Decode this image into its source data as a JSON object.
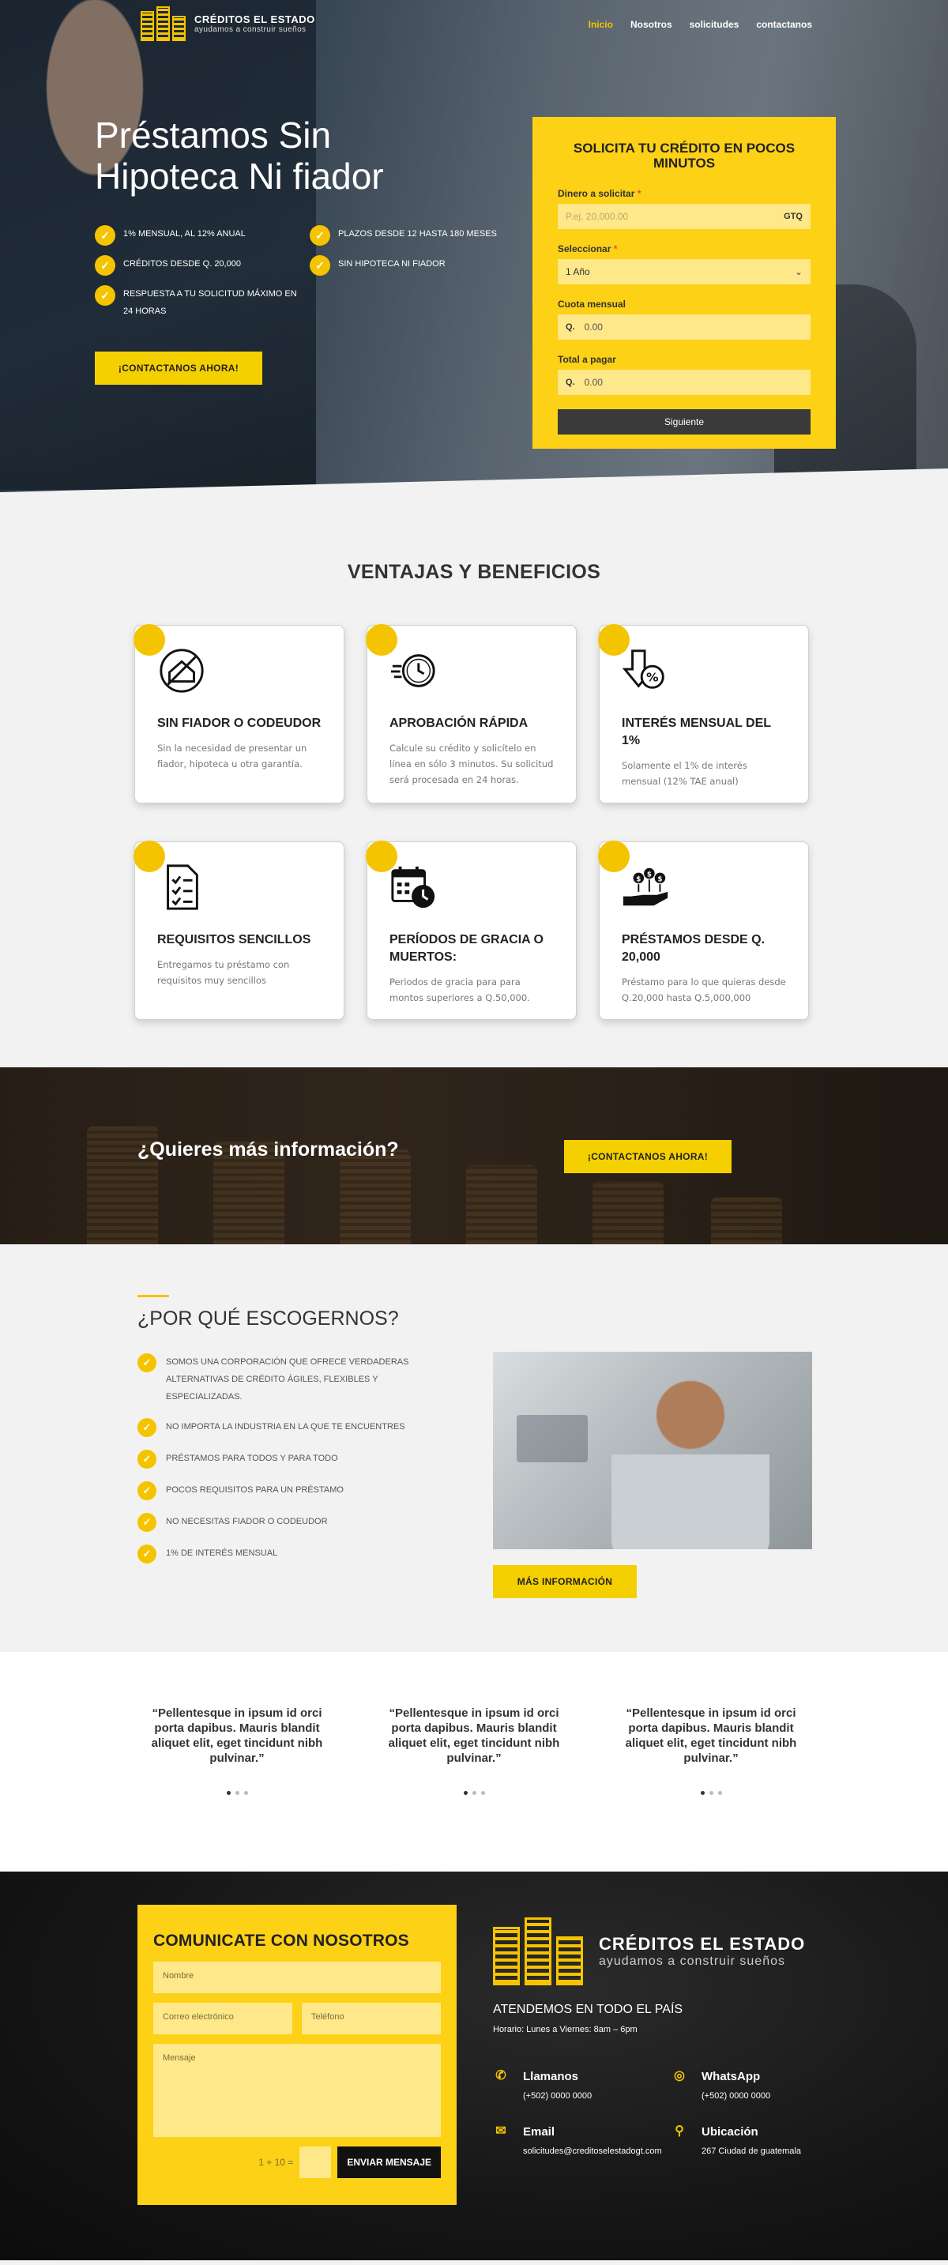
{
  "brand": {
    "name": "CRÉDITOS EL ESTADO",
    "tagline": "ayudamos a construir sueños"
  },
  "nav": {
    "items": [
      "Inicio",
      "Nosotros",
      "solicitudes",
      "contactanos"
    ],
    "active": 0
  },
  "hero": {
    "title": "Préstamos Sin Hipoteca Ni fiador",
    "checks": [
      "1% MENSUAL, AL 12% ANUAL",
      "PLAZOS DESDE 12 HASTA 180 MESES",
      "CRÉDITOS DESDE Q. 20,000",
      "SIN HIPOTECA NI FIADOR",
      "RESPUESTA A TU SOLICITUD MÁXIMO EN 24 HORAS"
    ],
    "cta": "¡CONTACTANOS AHORA!"
  },
  "loan_form": {
    "title": "SOLICITA TU CRÉDITO EN POCOS MINUTOS",
    "amount_label": "Dinero a solicitar",
    "amount_placeholder": "P.ej. 20,000.00",
    "amount_suffix": "GTQ",
    "term_label": "Seleccionar",
    "term_value": "1 Año",
    "quota_label": "Cuota mensual",
    "quota_prefix": "Q.",
    "quota_value": "0.00",
    "total_label": "Total a pagar",
    "total_prefix": "Q.",
    "total_value": "0.00",
    "submit": "Siguiente",
    "required_mark": "*"
  },
  "benefits": {
    "title": "VENTAJAS Y BENEFICIOS",
    "cards": [
      {
        "icon": "house-no-guarantor-icon",
        "title": "SIN FIADOR O CODEUDOR",
        "text": "Sin la necesidad de presentar un fiador, hipoteca u otra garantía."
      },
      {
        "icon": "fast-clock-icon",
        "title": "APROBACIÓN RÁPIDA",
        "text": "Calcule su crédito y solicítelo en línea en sólo 3 minutos. Su solicitud será procesada en 24 horas."
      },
      {
        "icon": "percent-down-arrow-icon",
        "title": "INTERÉS MENSUAL DEL 1%",
        "text": "Solamente el 1% de interés mensual (12% TAE anual)"
      },
      {
        "icon": "checklist-icon",
        "title": "REQUISITOS SENCILLOS",
        "text": "Entregamos tu préstamo con requisitos muy sencillos"
      },
      {
        "icon": "calendar-clock-icon",
        "title": "PERÍODOS DE GRACIA O MUERTOS:",
        "text": "Periodos de gracia para para montos superiores a Q.50,000."
      },
      {
        "icon": "hand-coins-icon",
        "title": "PRÉSTAMOS DESDE Q. 20,000",
        "text": "Préstamo para lo que quieras desde Q.20,000 hasta Q.5,000,000"
      }
    ]
  },
  "band": {
    "title": "¿Quieres más información?",
    "cta": "¡CONTACTANOS AHORA!"
  },
  "why": {
    "title": "¿POR QUÉ ESCOGERNOS?",
    "items": [
      "SOMOS UNA CORPORACIÓN QUE OFRECE VERDADERAS ALTERNATIVAS DE CRÉDITO ÁGILES, FLEXIBLES Y ESPECIALIZADAS.",
      "NO IMPORTA LA INDUSTRIA EN LA QUE TE ENCUENTRES",
      "PRÉSTAMOS PARA TODOS Y PARA TODO",
      "POCOS REQUISITOS PARA UN PRÉSTAMO",
      "NO NECESITAS FIADOR O CODEUDOR",
      "1% DE INTERÉS MENSUAL"
    ],
    "cta": "MÁS INFORMACIÓN"
  },
  "testimonials": [
    "“Pellentesque in ipsum id orci porta dapibus. Mauris blandit aliquet elit, eget tincidunt nibh pulvinar.”",
    "“Pellentesque in ipsum id orci porta dapibus. Mauris blandit aliquet elit, eget tincidunt nibh pulvinar.”",
    "“Pellentesque in ipsum id orci porta dapibus. Mauris blandit aliquet elit, eget tincidunt nibh pulvinar.”"
  ],
  "contact_form": {
    "title": "COMUNICATE CON NOSOTROS",
    "name_placeholder": "Nombre",
    "email_placeholder": "Correo electrónico",
    "phone_placeholder": "Teléfono",
    "message_placeholder": "Mensaje",
    "captcha": "1 + 10 =",
    "submit": "ENVIAR MENSAJE"
  },
  "footer": {
    "heading": "ATENDEMOS EN TODO EL PAÍS",
    "hours": "Horario: Lunes a Viernes: 8am – 6pm",
    "contacts": [
      {
        "icon": "phone-icon",
        "title": "Llamanos",
        "value": "(+502) 0000 0000"
      },
      {
        "icon": "whatsapp-icon",
        "title": "WhatsApp",
        "value": "(+502) 0000 0000"
      },
      {
        "icon": "email-icon",
        "title": "Email",
        "value": "solicitudes@creditoselestadogt.com"
      },
      {
        "icon": "location-pin-icon",
        "title": "Ubicación",
        "value": "267 Ciudad de guatemala"
      }
    ]
  },
  "colors": {
    "accent": "#f5c400",
    "form_bg": "#fcd116",
    "input_bg": "#ffe88a",
    "dark": "#3a3a3a"
  }
}
